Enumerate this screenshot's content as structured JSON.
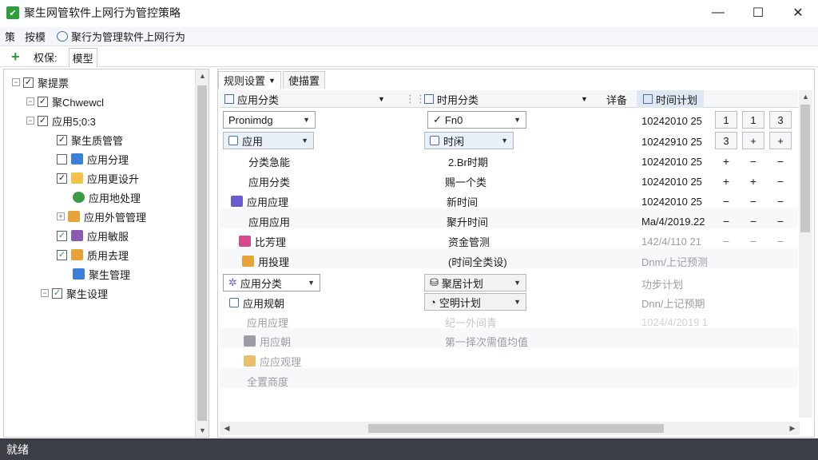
{
  "window": {
    "title": "聚生网管软件上网行为管控策略",
    "minimize": "—",
    "maximize": "☐",
    "close": "✕"
  },
  "menu": {
    "items": [
      "策",
      "按模"
    ],
    "policy_label": "聚行为管理软件上网行为"
  },
  "toolbar": {
    "add": "+",
    "tab1": "权保:",
    "tab2": "模型"
  },
  "tree": {
    "items": [
      {
        "label": "聚提票"
      },
      {
        "label": "聚Chwewcl"
      },
      {
        "label": "应用5;0:3"
      },
      {
        "label": "聚生质管管"
      },
      {
        "label": "应用分理"
      },
      {
        "label": "应用更设升"
      },
      {
        "label": "应用地处理"
      },
      {
        "label": "应用外管管理"
      },
      {
        "label": "应用敏服"
      },
      {
        "label": "质用去理"
      },
      {
        "label": "聚生管理"
      },
      {
        "label": "聚生设理"
      }
    ]
  },
  "right": {
    "tabs": [
      "规则设置",
      "使描置"
    ],
    "headers": {
      "app_category": "应用分类",
      "time_category": "时用分类",
      "detail": "详备",
      "time_plan": "时间计划"
    },
    "rows": [
      {
        "app": "Pronimdg",
        "time": "Fn0",
        "plan": "10242010 25",
        "b1": "1",
        "b2": "1",
        "b3": "3"
      },
      {
        "app": "应用",
        "time": "时闲",
        "plan": "10242910 25",
        "b1": "3",
        "b2": "+",
        "b3": "+"
      },
      {
        "app": "分类急能",
        "time": "2.Br时期",
        "plan": "10242010 25",
        "b1": "+",
        "b2": "−",
        "b3": "−"
      },
      {
        "app": "应用分类",
        "time": "赐一个类",
        "plan": "10242010 25",
        "b1": "+",
        "b2": "+",
        "b3": "−"
      },
      {
        "app": "应用应理",
        "time": "新时间",
        "plan": "10242010 25",
        "b1": "−",
        "b2": "−",
        "b3": "−"
      },
      {
        "app": "应用应用",
        "time": "聚升时间",
        "plan": "Ma/4/2019.22",
        "b1": "−",
        "b2": "−",
        "b3": "−"
      },
      {
        "app": "比芳理",
        "time": "资金管测",
        "plan": "142/4/110 21",
        "b1": "−",
        "b2": "−",
        "b3": "−"
      },
      {
        "app": "用投理",
        "time": "(时间全类设)",
        "plan": "Dnm/上记预测"
      },
      {
        "app": "应用分类",
        "time": "聚居计划",
        "plan": "功步计划"
      },
      {
        "app": "应用规朝",
        "time": "空明计划",
        "plan": "Dnn/上记预期"
      },
      {
        "app": "应用应理",
        "time": "纪一外间青",
        "plan": "1024/4/2019 1"
      },
      {
        "app": "用应朝",
        "time": "第一择次需值均值",
        "plan": ""
      },
      {
        "app": "应应观理",
        "time": "",
        "plan": ""
      },
      {
        "app": "全置商度",
        "time": "",
        "plan": ""
      }
    ]
  },
  "status": {
    "text": "就绪"
  }
}
